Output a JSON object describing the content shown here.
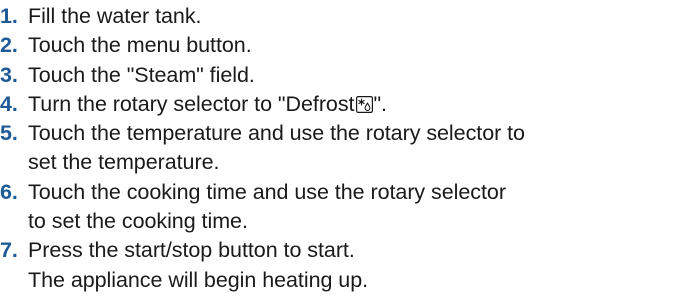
{
  "accent_color": "#1e5a96",
  "text_color": "#1a1a1a",
  "steps": [
    {
      "number": "1.",
      "lines": [
        "Fill the water tank."
      ]
    },
    {
      "number": "2.",
      "lines": [
        "Touch the menu button."
      ]
    },
    {
      "number": "3.",
      "lines": [
        "Touch the \"Steam\" field."
      ]
    },
    {
      "number": "4.",
      "text_before_icon": "Turn the rotary selector to \"Defrost",
      "icon": "defrost-icon",
      "text_after_icon": "\"."
    },
    {
      "number": "5.",
      "lines": [
        "Touch the temperature and use the rotary selector to",
        "set the temperature."
      ]
    },
    {
      "number": "6.",
      "lines": [
        "Touch the cooking time and use the rotary selector",
        "to set the cooking time."
      ]
    },
    {
      "number": "7.",
      "lines": [
        "Press the start/stop button to start.",
        "The appliance will begin heating up."
      ]
    }
  ]
}
